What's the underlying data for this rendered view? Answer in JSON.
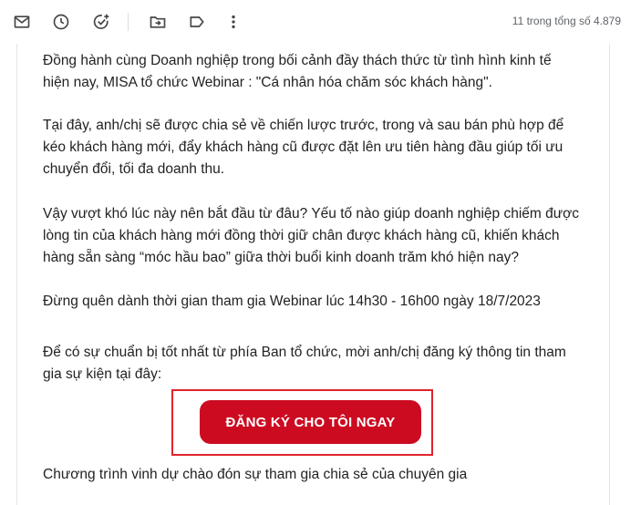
{
  "toolbar": {
    "icons": [
      "mail-icon",
      "clock-icon",
      "add-task-icon",
      "move-to-icon",
      "label-icon",
      "more-vert-icon"
    ],
    "counter": "11 trong tổng số 4.879"
  },
  "email": {
    "paragraph1": "Đồng hành cùng Doanh nghiệp trong bối cảnh đầy thách thức từ tình hình kinh tế hiện nay, MISA tổ chức Webinar : \"Cá nhân hóa chăm sóc khách hàng\".",
    "paragraph2": "Tại đây, anh/chị sẽ được chia sẻ về chiến lược trước, trong và sau bán phù hợp để kéo khách hàng mới, đẩy khách hàng cũ được đặt lên ưu tiên hàng đầu giúp tối ưu chuyển đổi, tối đa doanh thu.",
    "paragraph3": "Vậy vượt khó lúc này nên bắt đầu từ đâu? Yếu tố nào giúp doanh nghiệp chiếm được lòng tin của khách hàng mới đồng thời giữ chân được khách hàng cũ, khiến khách hàng sẵn sàng “móc hầu bao” giữa thời buổi kinh doanh trăm khó hiện nay?",
    "paragraph4": "Đừng quên dành thời gian tham gia Webinar lúc 14h30 - 16h00 ngày 18/7/2023",
    "paragraph5": "Để có sự chuẩn bị tốt nhất từ phía Ban tổ chức, mời anh/chị đăng ký thông tin tham gia sự kiện tại đây:",
    "cta_label": "ĐĂNG KÝ CHO TÔI NGAY",
    "paragraph6": "Chương trình vinh dự chào đón sự tham gia chia sẻ của chuyên gia"
  },
  "colors": {
    "cta_background": "#cc0b21",
    "highlight_frame": "#e0232a",
    "icon": "#444746"
  }
}
